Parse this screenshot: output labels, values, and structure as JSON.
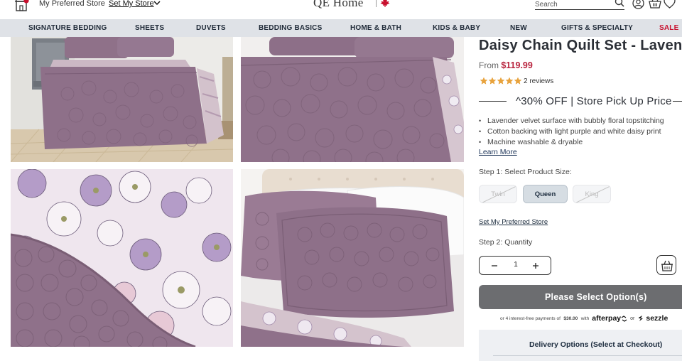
{
  "header": {
    "preferred_store_label": "My Preferred Store",
    "set_store_label": "Set My Store",
    "logo_text": "QE Home",
    "search_placeholder": "Search"
  },
  "nav": {
    "items": [
      {
        "label": "SIGNATURE BEDDING"
      },
      {
        "label": "SHEETS"
      },
      {
        "label": "DUVETS"
      },
      {
        "label": "BEDDING BASICS"
      },
      {
        "label": "HOME & BATH"
      },
      {
        "label": "KIDS & BABY"
      },
      {
        "label": "NEW"
      },
      {
        "label": "GIFTS & SPECIALTY"
      },
      {
        "label": "SALE"
      }
    ],
    "sale_color": "#c8102e"
  },
  "gallery": {
    "images": [
      {
        "icon": "lavender-quilt-bedroom-photo"
      },
      {
        "icon": "lavender-quilt-closeup-photo"
      },
      {
        "icon": "daisy-print-reverse-photo"
      },
      {
        "icon": "lavender-pillow-shams-photo"
      }
    ]
  },
  "product": {
    "title": "Daisy Chain Quilt Set - Lavend",
    "from_label": "From",
    "price": "$119.99",
    "rating": 5,
    "reviews": "2 reviews",
    "promo": "^30% OFF | Store Pick Up Price",
    "features": [
      "Lavender velvet surface with bubbly floral topstitching",
      "Cotton backing with light purple and white daisy print",
      "Machine washable & dryable"
    ],
    "learn_more": "Learn More",
    "step1_label": "Step 1: Select Product Size:",
    "sizes": [
      {
        "label": "Twin",
        "available": false
      },
      {
        "label": "Queen",
        "available": true
      },
      {
        "label": "King",
        "available": false
      }
    ],
    "set_preferred_store": "Set My Preferred Store",
    "step2_label": "Step 2: Quantity",
    "quantity": "1",
    "cta_label": "Please Select Option(s)",
    "afterpay_prefix": "or 4 interest-free payments of",
    "afterpay_amount": "$30.00",
    "afterpay_with": "with",
    "afterpay_logo": "afterpay",
    "or_text": "or",
    "sezzle_logo": "sezzle",
    "delivery_label": "Delivery Options (Select at Checkout)",
    "price_color": "#b8233d",
    "star_color": "#e8a33d"
  }
}
